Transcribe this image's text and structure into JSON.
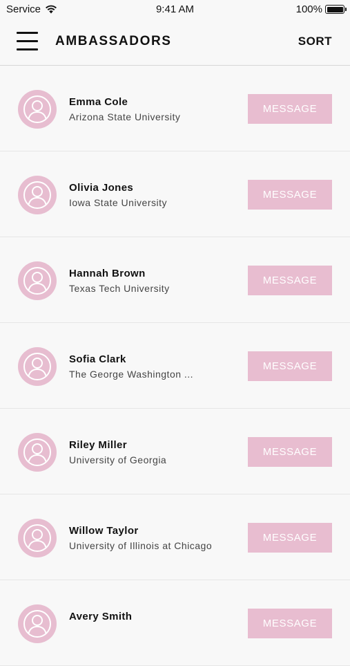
{
  "status_bar": {
    "carrier": "Service",
    "time": "9:41 AM",
    "battery": "100%"
  },
  "nav": {
    "title": "AMBASSADORS",
    "sort_label": "SORT"
  },
  "colors": {
    "accent_pink": "#e8bdd0",
    "background": "#f8f8f8"
  },
  "ambassadors": [
    {
      "name": "Emma Cole",
      "school": "Arizona State University",
      "action": "MESSAGE"
    },
    {
      "name": "Olivia Jones",
      "school": "Iowa State University",
      "action": "MESSAGE"
    },
    {
      "name": "Hannah Brown",
      "school": "Texas Tech University",
      "action": "MESSAGE"
    },
    {
      "name": "Sofia Clark",
      "school": "The George Washington ...",
      "action": "MESSAGE"
    },
    {
      "name": "Riley Miller",
      "school": "University of Georgia",
      "action": "MESSAGE"
    },
    {
      "name": "Willow Taylor",
      "school": "University of Illinois at Chicago",
      "action": "MESSAGE"
    },
    {
      "name": "Avery Smith",
      "school": "",
      "action": "MESSAGE"
    }
  ]
}
